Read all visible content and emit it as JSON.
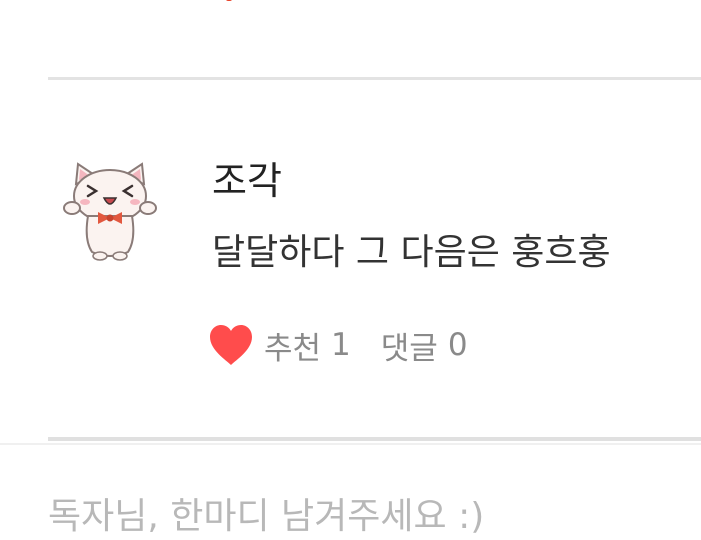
{
  "comment": {
    "avatar_icon": "white-cat-with-bowtie-icon",
    "author": "조각",
    "text": "달달하다 그 다음은 훙흐훙",
    "like_label": "추천",
    "like_count": "1",
    "reply_label": "댓글",
    "reply_count": "0"
  },
  "reply_input": {
    "placeholder": "독자님, 한마디 남겨주세요 :)"
  },
  "colors": {
    "heart": "#ff4c4c",
    "meta_text": "#8a8a8a",
    "divider": "#e3e3e3",
    "placeholder": "#b8b8b8"
  }
}
